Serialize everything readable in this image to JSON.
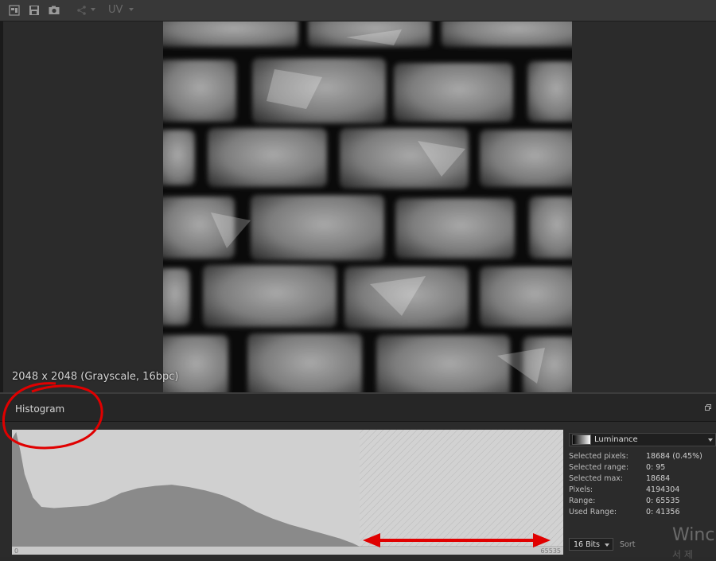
{
  "toolbar": {
    "icons": [
      "image-properties-icon",
      "save-icon",
      "snapshot-icon",
      "share-icon"
    ],
    "uv_label": "UV"
  },
  "viewport": {
    "image_info": "2048 x 2048 (Grayscale, 16bpc)"
  },
  "histogram_panel": {
    "title": "Histogram",
    "axis_min": "0",
    "axis_max": "65535",
    "channel": "Luminance",
    "stats": [
      {
        "label": "Selected pixels:",
        "value": "18684 (0.45%)"
      },
      {
        "label": "Selected range:",
        "value": "0: 95"
      },
      {
        "label": "Selected max:",
        "value": "18684"
      },
      {
        "label": "Pixels:",
        "value": "4194304"
      },
      {
        "label": "Range:",
        "value": "0: 65535"
      },
      {
        "label": "Used Range:",
        "value": "0: 41356"
      }
    ],
    "bit_depth": "16 Bits",
    "sort_label": "Sort"
  },
  "chart_data": {
    "type": "area",
    "x_range": [
      0,
      65535
    ],
    "used_range": [
      0,
      41356
    ],
    "x": [
      0,
      500,
      1000,
      1500,
      2500,
      3500,
      5000,
      7000,
      9000,
      11000,
      13000,
      15000,
      17000,
      19000,
      21000,
      23000,
      25000,
      27000,
      29000,
      31000,
      33000,
      35000,
      37000,
      39000,
      40500,
      41356
    ],
    "values": [
      0.92,
      0.98,
      0.82,
      0.62,
      0.42,
      0.34,
      0.33,
      0.34,
      0.35,
      0.39,
      0.46,
      0.5,
      0.52,
      0.53,
      0.51,
      0.48,
      0.44,
      0.38,
      0.3,
      0.24,
      0.19,
      0.15,
      0.11,
      0.07,
      0.03,
      0.0
    ]
  },
  "watermark": {
    "line1": "Winc",
    "line2": "서 제"
  },
  "colors": {
    "background": "#2a2a2a",
    "histogram_bg": "#d0d0d0",
    "histogram_fill": "#8a8a8a",
    "annotation": "#e00000"
  }
}
